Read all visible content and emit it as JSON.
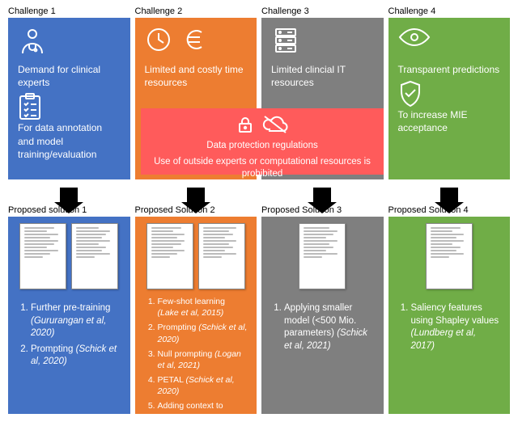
{
  "headings": {
    "c1": "Challenge 1",
    "c2": "Challenge 2",
    "c3": "Challenge 3",
    "c4": "Challenge 4"
  },
  "challenges": {
    "c1a": "Demand for clinical experts",
    "c1b": "For data annotation and model training/evaluation",
    "c2": "Limited and costly time resources",
    "c3": "Limited clincial IT resources",
    "c4a": "Transparent predictions",
    "c4b": "To increase MIE acceptance"
  },
  "overlay": {
    "line1": "Data protection regulations",
    "line2": "Use of outside experts or computational resources is prohibited"
  },
  "sol_headings": {
    "s1": "Proposed solution 1",
    "s2": "Proposed Solution 2",
    "s3": "Proposed Solution 3",
    "s4": "Proposed Solution 4"
  },
  "solutions": {
    "s1": {
      "items": [
        {
          "label": "Further pre-training ",
          "cite": "(Gururangan et al, 2020)"
        },
        {
          "label": "Prompting ",
          "cite": "(Schick et al, 2020)"
        }
      ]
    },
    "s2": {
      "items": [
        {
          "label": "Few-shot learning ",
          "cite": "(Lake et al, 2015)"
        },
        {
          "label": "Prompting ",
          "cite": "(Schick et al, 2020)"
        },
        {
          "label": "Null prompting ",
          "cite": "(Logan et al, 2021)"
        },
        {
          "label": "PETAL ",
          "cite": "(Schick et al, 2020)"
        },
        {
          "label": "Adding context to model input",
          "cite": ""
        }
      ]
    },
    "s3": {
      "items": [
        {
          "label": "Applying smaller model (<500 Mio. parameters) ",
          "cite": "(Schick et al, 2021)"
        }
      ]
    },
    "s4": {
      "items": [
        {
          "label": "Saliency features using Shapley values ",
          "cite": "(Lundberg et al, 2017)"
        }
      ]
    }
  },
  "icons": {
    "doctor": "doctor-icon",
    "checklist": "checklist-icon",
    "clock": "clock-icon",
    "euro": "euro-icon",
    "server": "server-icon",
    "eye": "eye-icon",
    "shield": "shield-check-icon",
    "lock": "lock-icon",
    "nocloud": "no-cloud-icon"
  }
}
